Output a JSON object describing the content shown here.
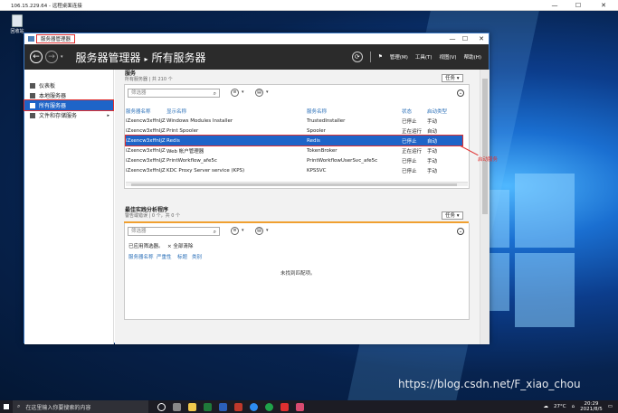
{
  "rdp": {
    "title": "106.15.229.64 - 远程桌面连接",
    "minimize": "—",
    "maximize": "☐",
    "close": "✕"
  },
  "desktop": {
    "recycle_label": "回收站",
    "watermark": "https://blog.csdn.net/F_xiao_chou"
  },
  "window": {
    "title": "服务器管理器",
    "minimize": "—",
    "maximize": "☐",
    "close": "✕"
  },
  "header": {
    "breadcrumb_root": "服务器管理器",
    "breadcrumb_sep": "▸",
    "breadcrumb_page": "所有服务器",
    "menu_manage": "管理(M)",
    "menu_tools": "工具(T)",
    "menu_view": "视图(V)",
    "menu_help": "帮助(H)"
  },
  "sidebar": {
    "items": [
      {
        "label": "仪表板"
      },
      {
        "label": "本地服务器"
      },
      {
        "label": "所有服务器"
      },
      {
        "label": "文件和存储服务"
      }
    ]
  },
  "services": {
    "title": "服务",
    "subtitle": "所有服务器 | 共 210 个",
    "tasks": "任务 ▾",
    "filter_placeholder": "筛选器",
    "columns": [
      "服务器名称",
      "显示名称",
      "服务名称",
      "状态",
      "启动类型"
    ],
    "rows": [
      [
        "iZxencw3xffnljZ",
        "Windows Modules Installer",
        "TrustedInstaller",
        "已停止",
        "手动"
      ],
      [
        "iZxencw3xffnljZ",
        "Print Spooler",
        "Spooler",
        "正在运行",
        "自动"
      ],
      [
        "iZxencw3xffnljZ",
        "Redis",
        "Redis",
        "已停止",
        "自动"
      ],
      [
        "iZxencw3xffnljZ",
        "Web 帐户管理器",
        "TokenBroker",
        "正在运行",
        "手动"
      ],
      [
        "iZxencw3xffnljZ",
        "PrintWorkflow_afe5c",
        "PrintWorkflowUserSvc_afe5c",
        "已停止",
        "手动"
      ],
      [
        "iZxencw3xffnljZ",
        "KDC Proxy Server service (KPS)",
        "KPSSVC",
        "已停止",
        "手动"
      ]
    ],
    "selected_index": 2,
    "annotation": "启动服务"
  },
  "bpa": {
    "title": "最佳实践分析程序",
    "subtitle": "警告或错误 | 0 个，共 0 个",
    "tasks": "任务 ▾",
    "filter_placeholder": "筛选器",
    "applied": "已应用筛选器。",
    "clear_all": "× 全部清除",
    "columns": [
      "服务器名称",
      "严重性",
      "标题",
      "类别"
    ],
    "no_match": "未找到匹配项。"
  },
  "taskbar": {
    "search_placeholder": "在这里输入你要搜索的内容",
    "weather": "27°C",
    "time": "20:29",
    "date": "2021/8/5"
  }
}
